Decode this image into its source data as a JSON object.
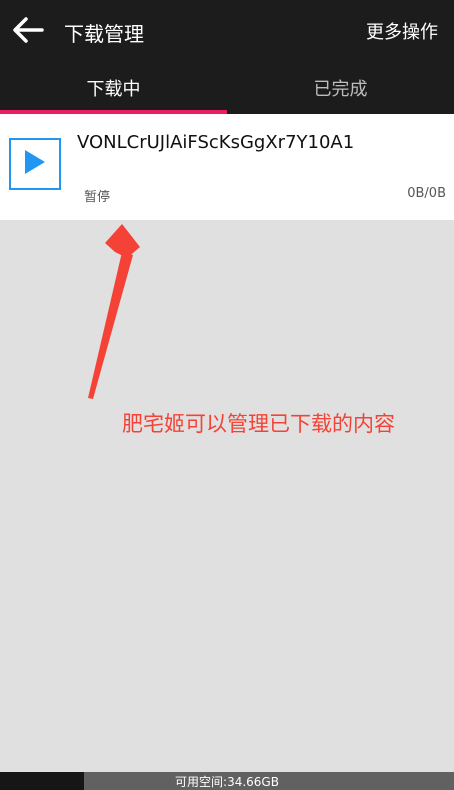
{
  "header": {
    "title": "下载管理",
    "more_actions": "更多操作"
  },
  "tabs": [
    {
      "label": "下载中",
      "active": true
    },
    {
      "label": "已完成",
      "active": false
    }
  ],
  "colors": {
    "accent": "#e91e63",
    "play": "#2196f3",
    "annotation": "#f44336"
  },
  "download_item": {
    "name": "VONLCrUJlAiFScKsGgXr7Y10A1",
    "status": "暂停",
    "size": "0B/0B",
    "icon": "play-icon"
  },
  "annotation": {
    "text": "肥宅姬可以管理已下载的内容"
  },
  "footer": {
    "storage_text": "可用空间:34.66GB"
  }
}
